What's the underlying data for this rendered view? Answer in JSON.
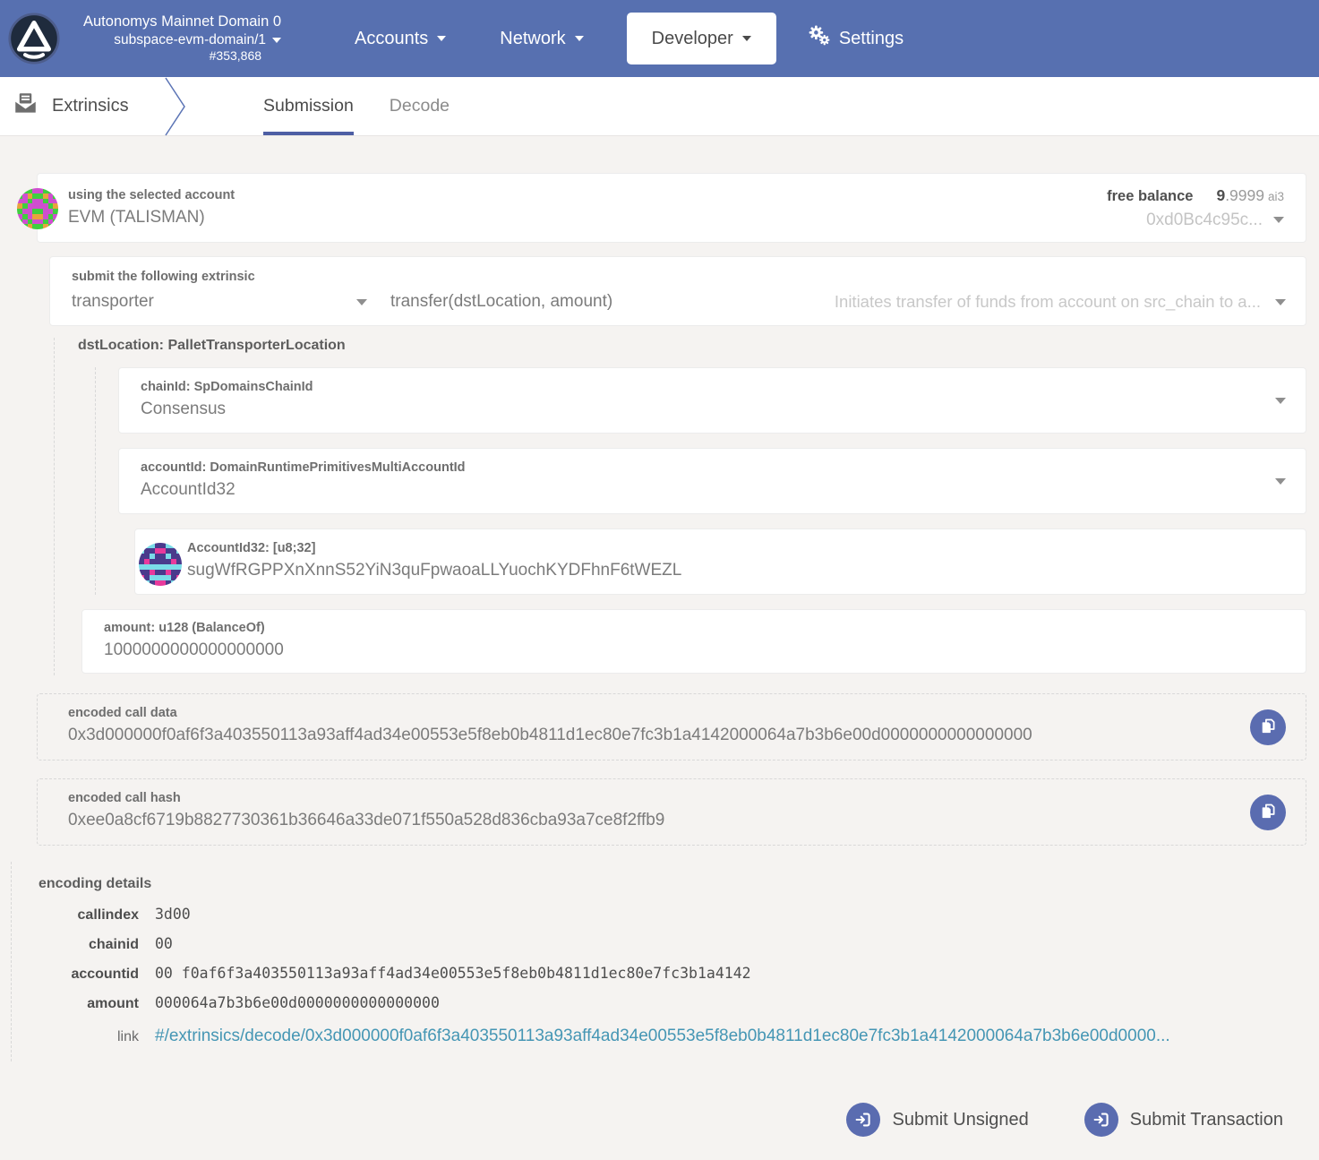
{
  "header": {
    "chain_name": "Autonomys Mainnet Domain 0",
    "domain": "subspace-evm-domain/1",
    "block_number": "#353,868",
    "nav": [
      {
        "label": "Accounts"
      },
      {
        "label": "Network"
      },
      {
        "label": "Developer"
      }
    ],
    "settings_label": "Settings"
  },
  "tabbar": {
    "section": "Extrinsics",
    "tabs": [
      {
        "label": "Submission",
        "active": true
      },
      {
        "label": "Decode",
        "active": false
      }
    ]
  },
  "account": {
    "label": "using the selected account",
    "name": "EVM (TALISMAN)",
    "free_balance_label": "free balance",
    "balance_int": "9",
    "balance_frac": ".9999",
    "balance_unit": "ai3",
    "address_short": "0xd0Bc4c95c..."
  },
  "extrinsic": {
    "label": "submit the following extrinsic",
    "pallet": "transporter",
    "method": "transfer(dstLocation, amount)",
    "description": "Initiates transfer of funds from account on src_chain to a..."
  },
  "params": {
    "dst_location_label": "dstLocation: PalletTransporterLocation",
    "chain_id": {
      "label": "chainId: SpDomainsChainId",
      "value": "Consensus"
    },
    "account_id": {
      "label": "accountId: DomainRuntimePrimitivesMultiAccountId",
      "value": "AccountId32"
    },
    "account_id32": {
      "label": "AccountId32: [u8;32]",
      "value": "sugWfRGPPXnXnnS52YiN3quFpwaoaLLYuochKYDFhnF6tWEZL"
    },
    "amount": {
      "label": "amount: u128 (BalanceOf)",
      "value": "1000000000000000000"
    }
  },
  "encoded": {
    "call_data_label": "encoded call data",
    "call_data": "0x3d000000f0af6f3a403550113a93aff4ad34e00553e5f8eb0b4811d1ec80e7fc3b1a4142000064a7b3b6e00d0000000000000000",
    "call_hash_label": "encoded call hash",
    "call_hash": "0xee0a8cf6719b8827730361b36646a33de071f550a528d836cba93a7ce8f2ffb9"
  },
  "encoding_details": {
    "title": "encoding details",
    "rows": [
      {
        "key": "callindex",
        "value": "3d00"
      },
      {
        "key": "chainid",
        "value": "00"
      },
      {
        "key": "accountid",
        "value": "00 f0af6f3a403550113a93aff4ad34e00553e5f8eb0b4811d1ec80e7fc3b1a4142"
      },
      {
        "key": "amount",
        "value": "000064a7b3b6e00d0000000000000000"
      }
    ],
    "link_key": "link",
    "link": "#/extrinsics/decode/0x3d000000f0af6f3a403550113a93aff4ad34e00553e5f8eb0b4811d1ec80e7fc3b1a4142000064a7b3b6e00d0000..."
  },
  "actions": {
    "submit_unsigned": "Submit Unsigned",
    "submit_transaction": "Submit Transaction"
  },
  "colors": {
    "header_bg": "#5770b0",
    "accent_button": "#5a6cb0",
    "tab_underline": "#4d5ea4",
    "link": "#4596b4",
    "page_bg": "#f5f3f1"
  },
  "identicons": {
    "account": {
      "palette": [
        "#3fcf3f",
        "#cf4fcf",
        "#e8a33d"
      ],
      "pattern": [
        "10011001",
        "01200210",
        "11011011",
        "20111102",
        "01100110",
        "10122101",
        "01011010",
        "10200201"
      ]
    },
    "account32": {
      "palette": [
        "#4a3a8c",
        "#7adce8",
        "#e83a9c"
      ],
      "pattern": [
        "01100110",
        "10022001",
        "00100100",
        "02000020",
        "11111111",
        "00200200",
        "20111102",
        "01022010"
      ]
    }
  }
}
